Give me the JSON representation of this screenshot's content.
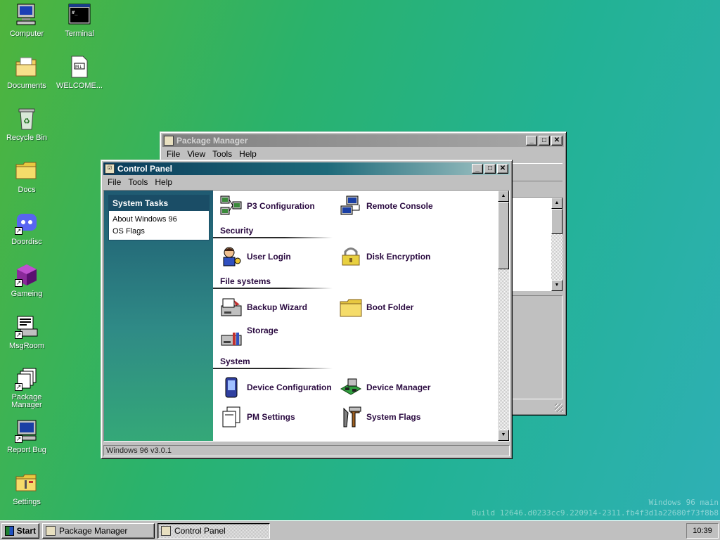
{
  "desktop": {
    "icons": [
      {
        "label": "Computer"
      },
      {
        "label": "Terminal"
      },
      {
        "label": "Documents"
      },
      {
        "label": "WELCOME..."
      },
      {
        "label": "Recycle Bin"
      },
      {
        "label": "Docs"
      },
      {
        "label": "Doordisc"
      },
      {
        "label": "Gameing"
      },
      {
        "label": "MsgRoom"
      },
      {
        "label": "Package Manager"
      },
      {
        "label": "Report Bug"
      },
      {
        "label": "Settings"
      }
    ],
    "watermark": {
      "line1": "Windows 96 main",
      "line2": "Build 12646.d0233cc9.220914-2311.fb4f3d1a22680f73f8b8"
    }
  },
  "package_manager": {
    "title": "Package Manager",
    "menu": [
      "File",
      "View",
      "Tools",
      "Help"
    ]
  },
  "control_panel": {
    "title": "Control Panel",
    "menu": [
      "File",
      "Tools",
      "Help"
    ],
    "system_tasks": {
      "heading": "System Tasks",
      "links": [
        "About Windows 96",
        "OS Flags"
      ]
    },
    "items": {
      "p3": "P3 Configuration",
      "remote": "Remote Console",
      "login": "User Login",
      "disk_enc": "Disk Encryption",
      "backup": "Backup Wizard",
      "boot": "Boot Folder",
      "storage": "Storage",
      "device_cfg": "Device Configuration",
      "device_mgr": "Device Manager",
      "pm_settings": "PM Settings",
      "sys_flags": "System Flags"
    },
    "sections": {
      "security": "Security",
      "filesystems": "File systems",
      "system": "System"
    },
    "status": "Windows 96 v3.0.1"
  },
  "taskbar": {
    "start": "Start",
    "tasks": [
      {
        "label": "Package Manager"
      },
      {
        "label": "Control Panel"
      }
    ],
    "clock": "10:39"
  }
}
